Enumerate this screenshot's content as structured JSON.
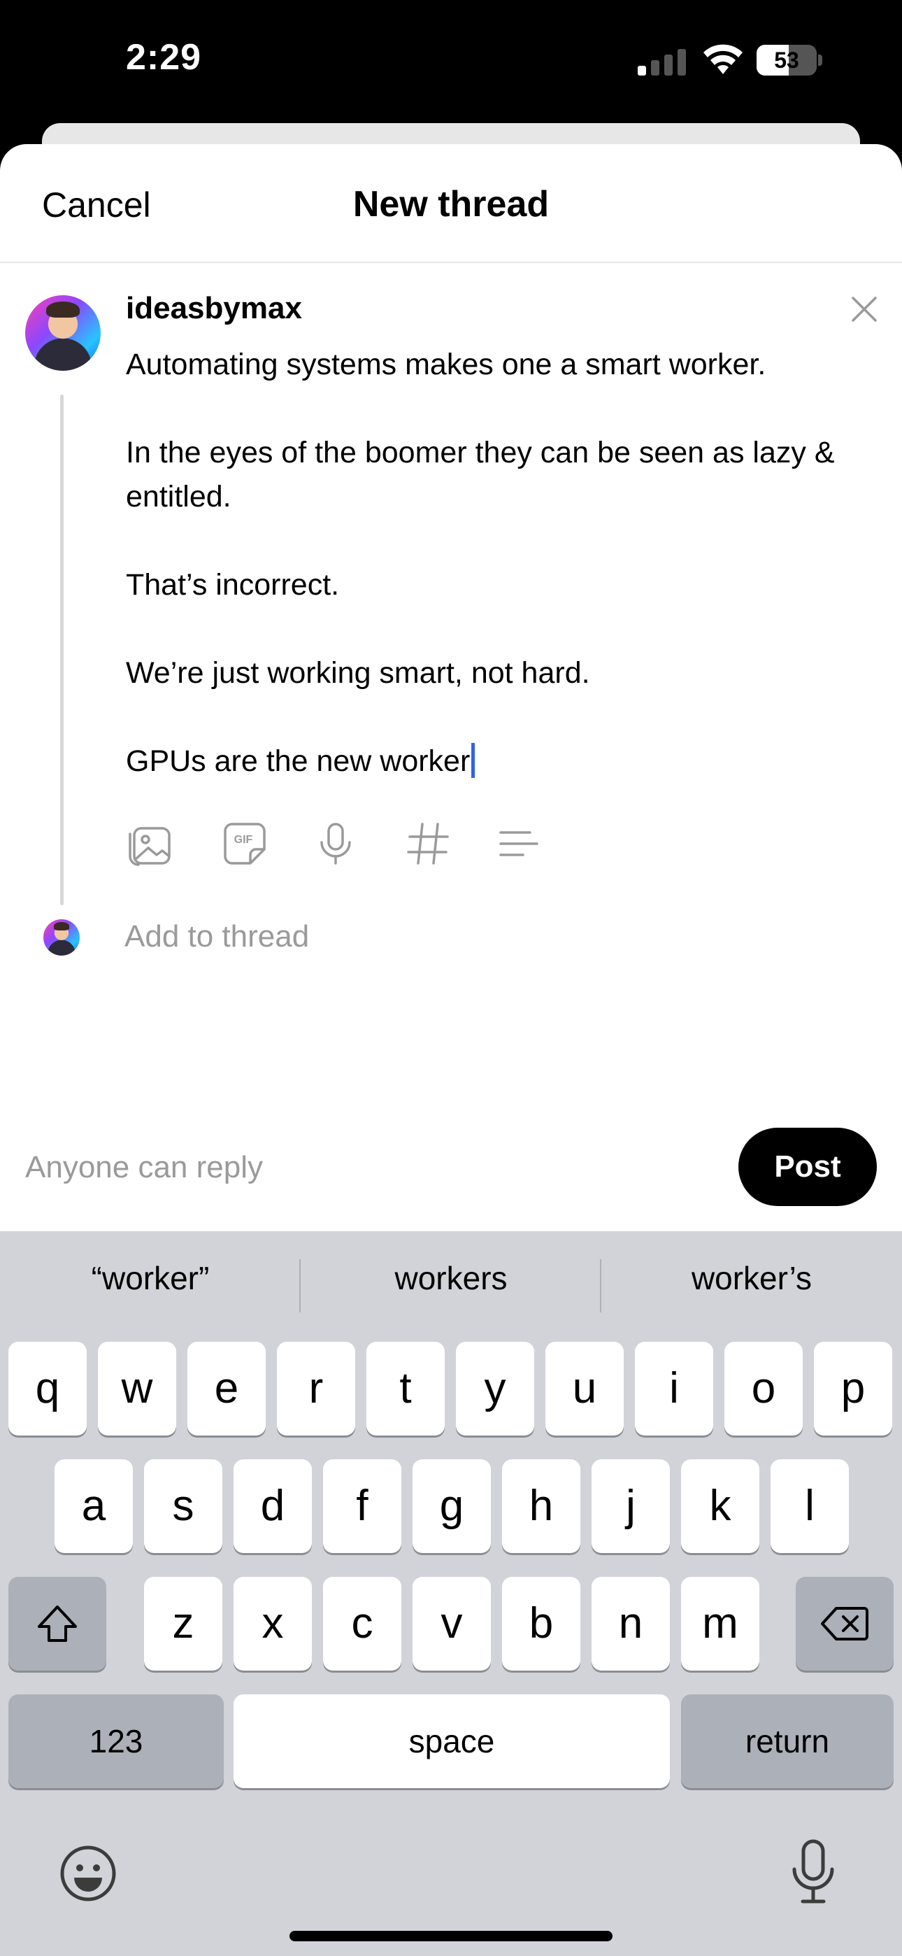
{
  "status_bar": {
    "time": "2:29",
    "battery_level": "53",
    "battery_fraction": 0.53,
    "signal_bars": 1,
    "icons": [
      "cellular-signal-icon",
      "wifi-icon",
      "battery-icon"
    ]
  },
  "header": {
    "cancel_label": "Cancel",
    "title": "New thread"
  },
  "composer": {
    "username": "ideasbymax",
    "body_lines": [
      "Automating systems makes one a smart worker.",
      "",
      "In the eyes of the boomer they can be seen as lazy & entitled.",
      "",
      "That’s incorrect.",
      "",
      "We’re just working smart, not hard.",
      "",
      "GPUs are the new worker"
    ],
    "toolbar_icons": [
      "image-icon",
      "gif-icon",
      "microphone-icon",
      "hashtag-icon",
      "text-align-icon"
    ],
    "add_to_thread": "Add to thread"
  },
  "footer": {
    "reply_setting": "Anyone can reply",
    "post_label": "Post"
  },
  "keyboard": {
    "suggestions": [
      "“worker”",
      "workers",
      "worker’s"
    ],
    "row1": [
      "q",
      "w",
      "e",
      "r",
      "t",
      "y",
      "u",
      "i",
      "o",
      "p"
    ],
    "row2": [
      "a",
      "s",
      "d",
      "f",
      "g",
      "h",
      "j",
      "k",
      "l"
    ],
    "row3": [
      "z",
      "x",
      "c",
      "v",
      "b",
      "n",
      "m"
    ],
    "numbers_label": "123",
    "space_label": "space",
    "return_label": "return"
  },
  "colors": {
    "accent_caret": "#2f64e8",
    "post_button_bg": "#000000",
    "muted_text": "#9a9a9a",
    "keyboard_bg": "#d1d3d9"
  }
}
